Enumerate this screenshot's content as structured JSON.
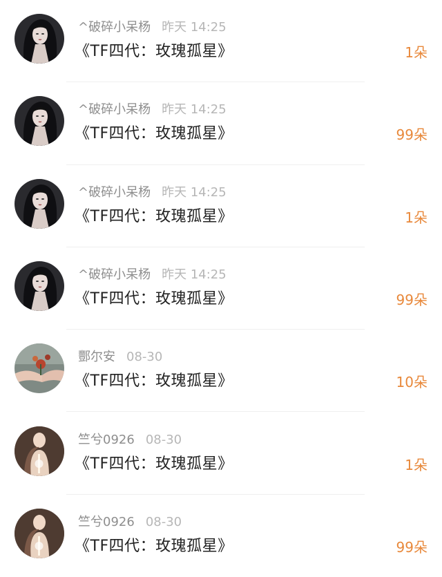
{
  "accent_color": "#e8883a",
  "comments": [
    {
      "username": "^破碎小呆杨",
      "time": "昨天 14:25",
      "title": "《TF四代：玫瑰孤星》",
      "gift": "1朵",
      "avatar": "woman-dark-hair-avatar"
    },
    {
      "username": "^破碎小呆杨",
      "time": "昨天 14:25",
      "title": "《TF四代：玫瑰孤星》",
      "gift": "99朵",
      "avatar": "woman-dark-hair-avatar"
    },
    {
      "username": "^破碎小呆杨",
      "time": "昨天 14:25",
      "title": "《TF四代：玫瑰孤星》",
      "gift": "1朵",
      "avatar": "woman-dark-hair-avatar"
    },
    {
      "username": "^破碎小呆杨",
      "time": "昨天 14:25",
      "title": "《TF四代：玫瑰孤星》",
      "gift": "99朵",
      "avatar": "woman-dark-hair-avatar"
    },
    {
      "username": "酆尔安",
      "time": "08-30",
      "title": "《TF四代：玫瑰孤星》",
      "gift": "10朵",
      "avatar": "hands-flower-avatar"
    },
    {
      "username": "竺兮0926",
      "time": "08-30",
      "title": "《TF四代：玫瑰孤星》",
      "gift": "1朵",
      "avatar": "figure-light-avatar"
    },
    {
      "username": "竺兮0926",
      "time": "08-30",
      "title": "《TF四代：玫瑰孤星》",
      "gift": "99朵",
      "avatar": "figure-light-avatar"
    }
  ]
}
